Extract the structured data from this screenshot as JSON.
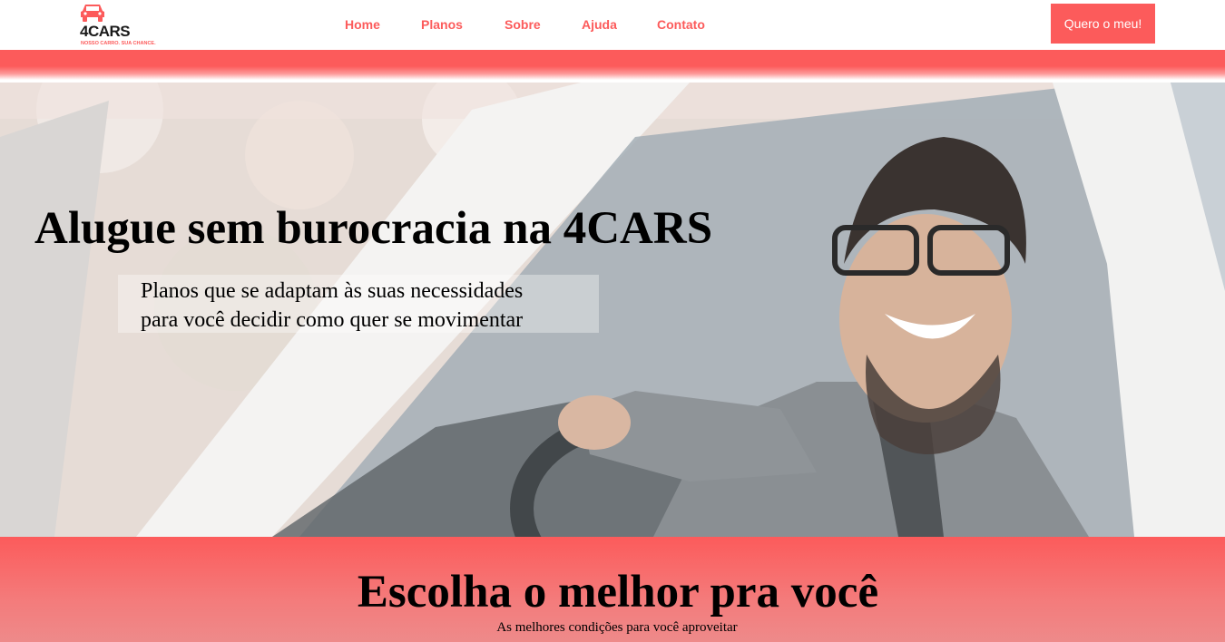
{
  "header": {
    "logo": {
      "name": "4CARS",
      "tagline": "NOSSO CARRO. SUA CHANCE.",
      "icon": "car-icon"
    },
    "nav": [
      {
        "label": "Home"
      },
      {
        "label": "Planos"
      },
      {
        "label": "Sobre"
      },
      {
        "label": "Ajuda"
      },
      {
        "label": "Contato"
      }
    ],
    "cta_label": "Quero o meu!"
  },
  "hero": {
    "title": "Alugue sem burocracia na 4CARS",
    "subtitle_line1": "Planos que se adaptam às suas necessidades",
    "subtitle_line2": "para você decidir como quer se movimentar",
    "image": "photo of smiling man with glasses driving a white car"
  },
  "plans": {
    "title": "Escolha o melhor pra você",
    "subtitle": "As melhores condições para você aproveitar"
  },
  "colors": {
    "accent": "#fc5b5b",
    "text": "#000000",
    "background": "#ffffff"
  }
}
